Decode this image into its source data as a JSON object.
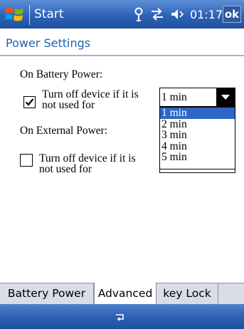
{
  "titlebar": {
    "app_title": "Start",
    "clock": "01:17",
    "ok_label": "ok",
    "icons": [
      "windows-flag-icon",
      "signal-icon",
      "connectivity-icon",
      "volume-icon"
    ]
  },
  "page": {
    "title": "Power Settings"
  },
  "battery": {
    "section_label": "On Battery Power:",
    "checkbox_checked": true,
    "option_line1": "Turn off device if it is",
    "option_line2": "not used for",
    "selected_value": "1 min",
    "dropdown_options": [
      "1 min",
      "2 min",
      "3 min",
      "4 min",
      "5 min"
    ]
  },
  "external": {
    "section_label": "On External Power:",
    "checkbox_checked": false,
    "option_line1": "Turn off device if it is",
    "option_line2": "not used for"
  },
  "tabs": [
    {
      "label": "Battery Power",
      "active": false
    },
    {
      "label": "Advanced",
      "active": true
    },
    {
      "label": "key Lock",
      "active": false
    }
  ],
  "colors": {
    "title_bar": "#2d63b8",
    "accent_text": "#1e5fb5",
    "selection": "#2f66c5"
  }
}
